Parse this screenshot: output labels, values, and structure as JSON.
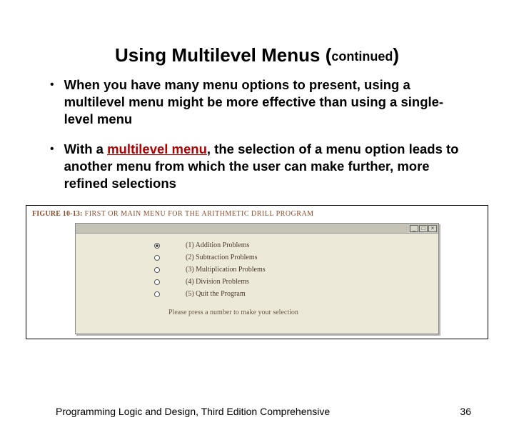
{
  "title": {
    "main": "Using Multilevel Menus ",
    "open": "(",
    "small": "continued",
    "close": ")"
  },
  "bullets": [
    {
      "dot": "•",
      "text": "When you have many menu options to present, using a multilevel menu might be more effective than using a single-level menu"
    },
    {
      "dot": "•",
      "prefix": "With a ",
      "keyword": "multilevel menu",
      "suffix": ", the selection of a menu option leads to another menu from which the user can make further, more refined selections"
    }
  ],
  "figure": {
    "label": "FIGURE 10-13:",
    "caption": "  FIRST OR MAIN MENU FOR THE ARITHMETIC DRILL PROGRAM",
    "window": {
      "min": "_",
      "max": "□",
      "close": "×",
      "items": [
        "(1) Addition Problems",
        "(2) Subtraction Problems",
        "(3) Multiplication Problems",
        "(4) Division Problems",
        "(5) Quit the Program"
      ],
      "prompt": "Please press a number to make your selection"
    }
  },
  "footer": {
    "book": "Programming Logic and Design, Third Edition Comprehensive",
    "page": "36"
  }
}
